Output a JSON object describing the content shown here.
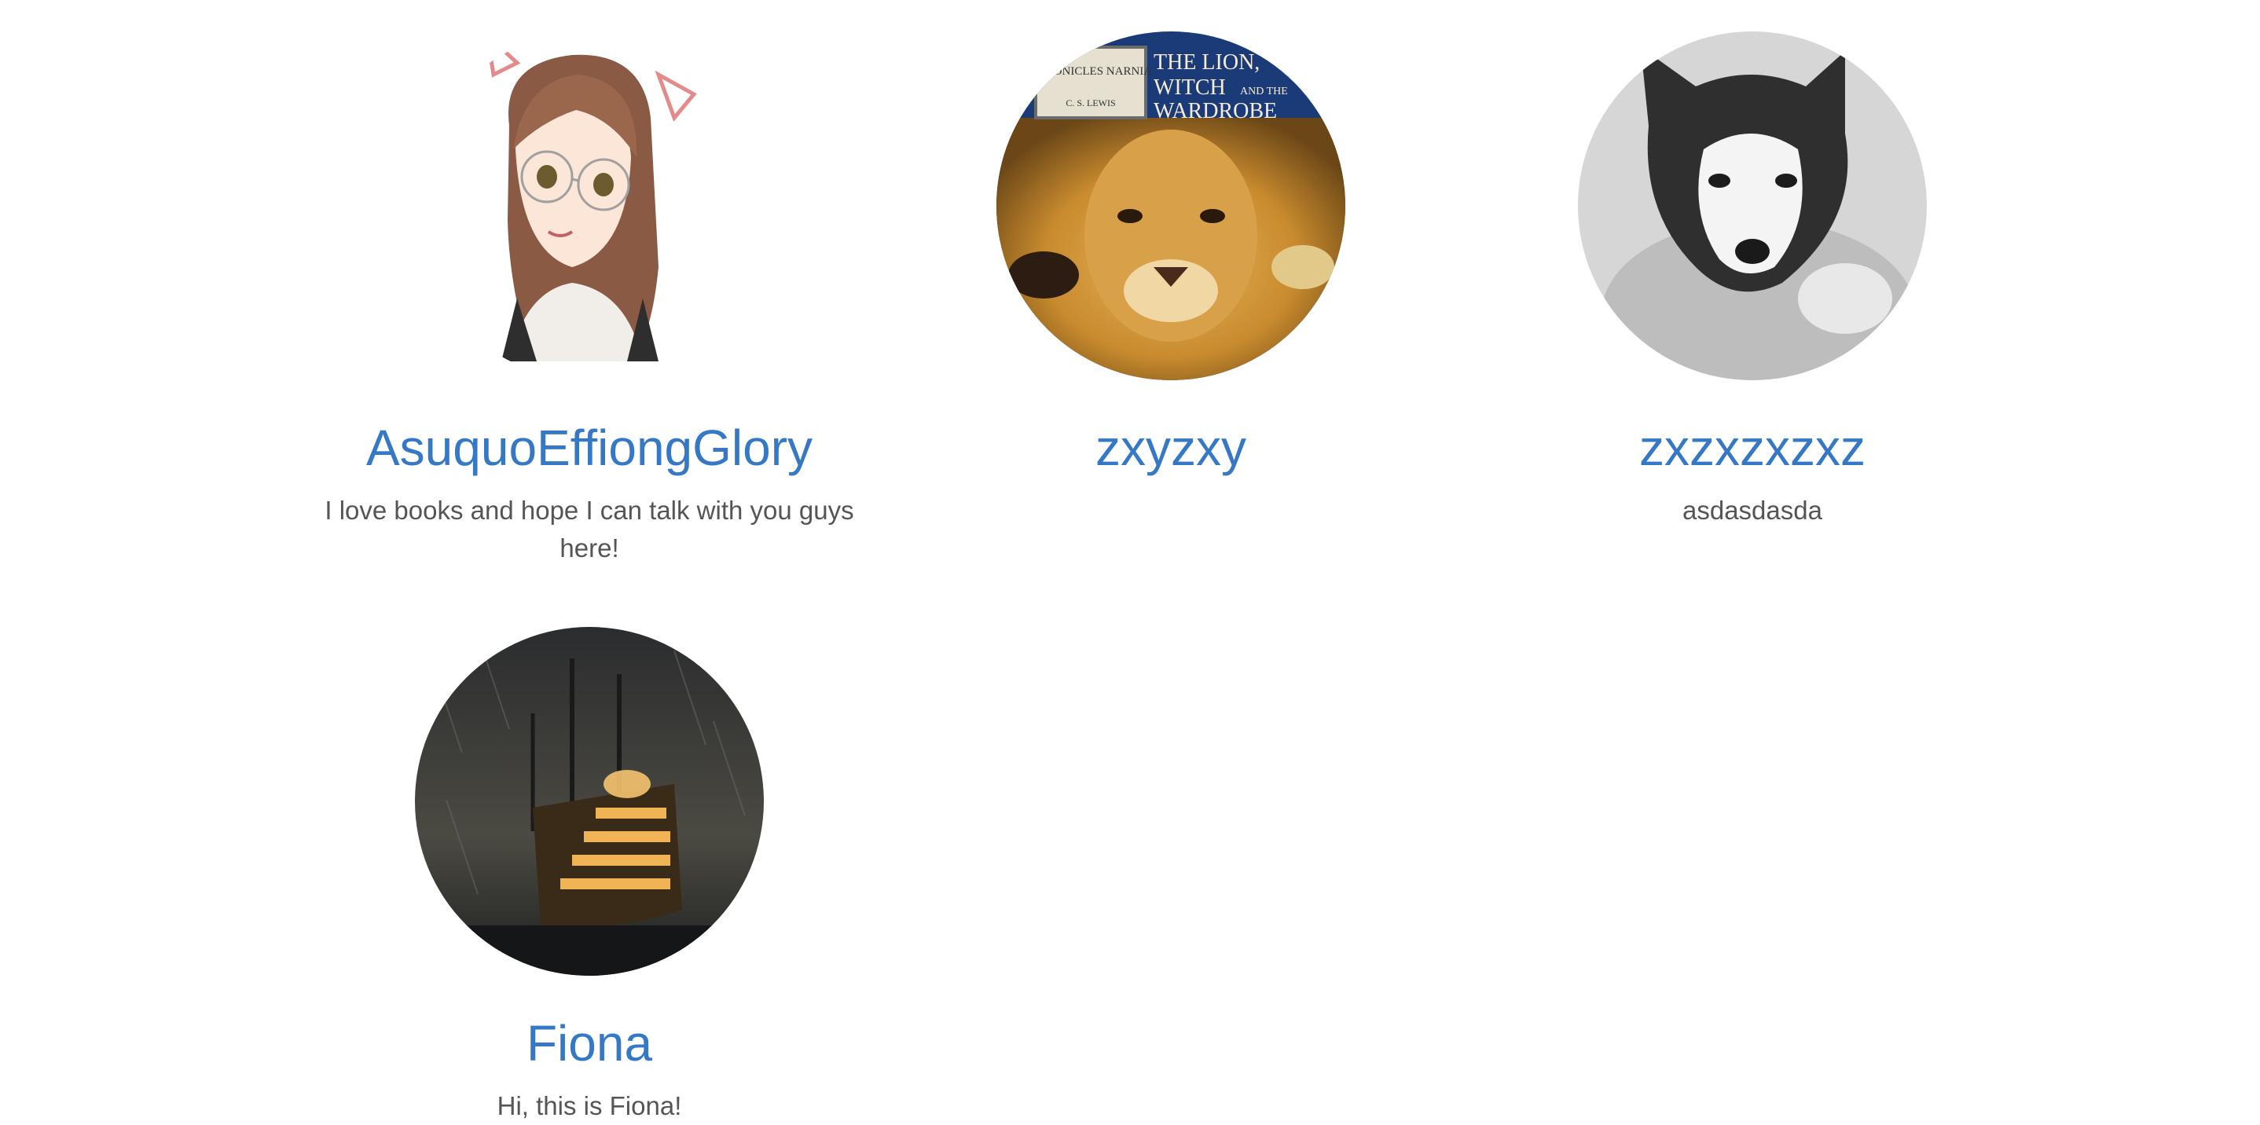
{
  "users": [
    {
      "name": "AsuquoEffiongGlory",
      "bio": "I love books and hope I can talk with you guys here!",
      "avatar_icon": "anime-girl-glasses-portrait"
    },
    {
      "name": "zxyzxy",
      "bio": "",
      "avatar_icon": "narnia-lion-book-cover",
      "avatar_text": {
        "series": "CHRONICLES NARNIA",
        "title_line1": "THE LION,",
        "title_line2": "WITCH",
        "title_and_the": "AND THE",
        "title_line3": "WARDROBE",
        "author": "C. S. LEWIS"
      }
    },
    {
      "name": "zxzxzxzxz",
      "bio": "asdasdasda",
      "avatar_icon": "husky-puppy-sketch"
    },
    {
      "name": "Fiona",
      "bio": "Hi, this is Fiona!",
      "avatar_icon": "ghost-ship-storm"
    }
  ],
  "colors": {
    "link": "#3478c6",
    "bio_text": "#555555",
    "background": "#ffffff"
  }
}
